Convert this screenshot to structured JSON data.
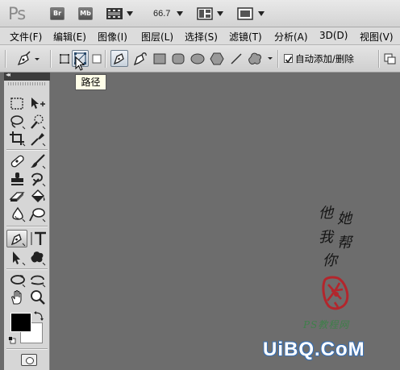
{
  "app": {
    "logo": "Ps",
    "bridge_label": "Br",
    "minibridge_label": "Mb",
    "zoom": "66.7"
  },
  "menu": [
    "文件(F)",
    "编辑(E)",
    "图像(I)",
    "图层(L)",
    "选择(S)",
    "滤镜(T)",
    "分析(A)",
    "3D(D)",
    "视图(V)"
  ],
  "options": {
    "auto_add_delete_label": "自动添加/删除",
    "auto_add_delete_checked": true
  },
  "tooltip": {
    "text": "路径"
  },
  "tools": [
    "marquee-tool",
    "move-tool",
    "lasso-tool",
    "quick-selection-tool",
    "crop-tool",
    "eyedropper-tool",
    "spot-healing-tool",
    "brush-tool",
    "clone-stamp-tool",
    "history-brush-tool",
    "eraser-tool",
    "paint-bucket-tool",
    "blur-tool",
    "dodge-tool",
    "pen-tool",
    "type-tool",
    "path-selection-tool",
    "custom-shape-tool",
    "3d-rotate-tool",
    "3d-orbit-tool",
    "hand-tool",
    "zoom-tool"
  ],
  "colors": {
    "foreground": "#000000",
    "background": "#ffffff"
  },
  "watermarks": {
    "calligraphy_lines": [
      [
        "他",
        "她"
      ],
      [
        "我",
        "帮"
      ],
      [
        "你"
      ]
    ],
    "ps_site": "PS教程网",
    "uibq": "UiBQ.CoM"
  }
}
